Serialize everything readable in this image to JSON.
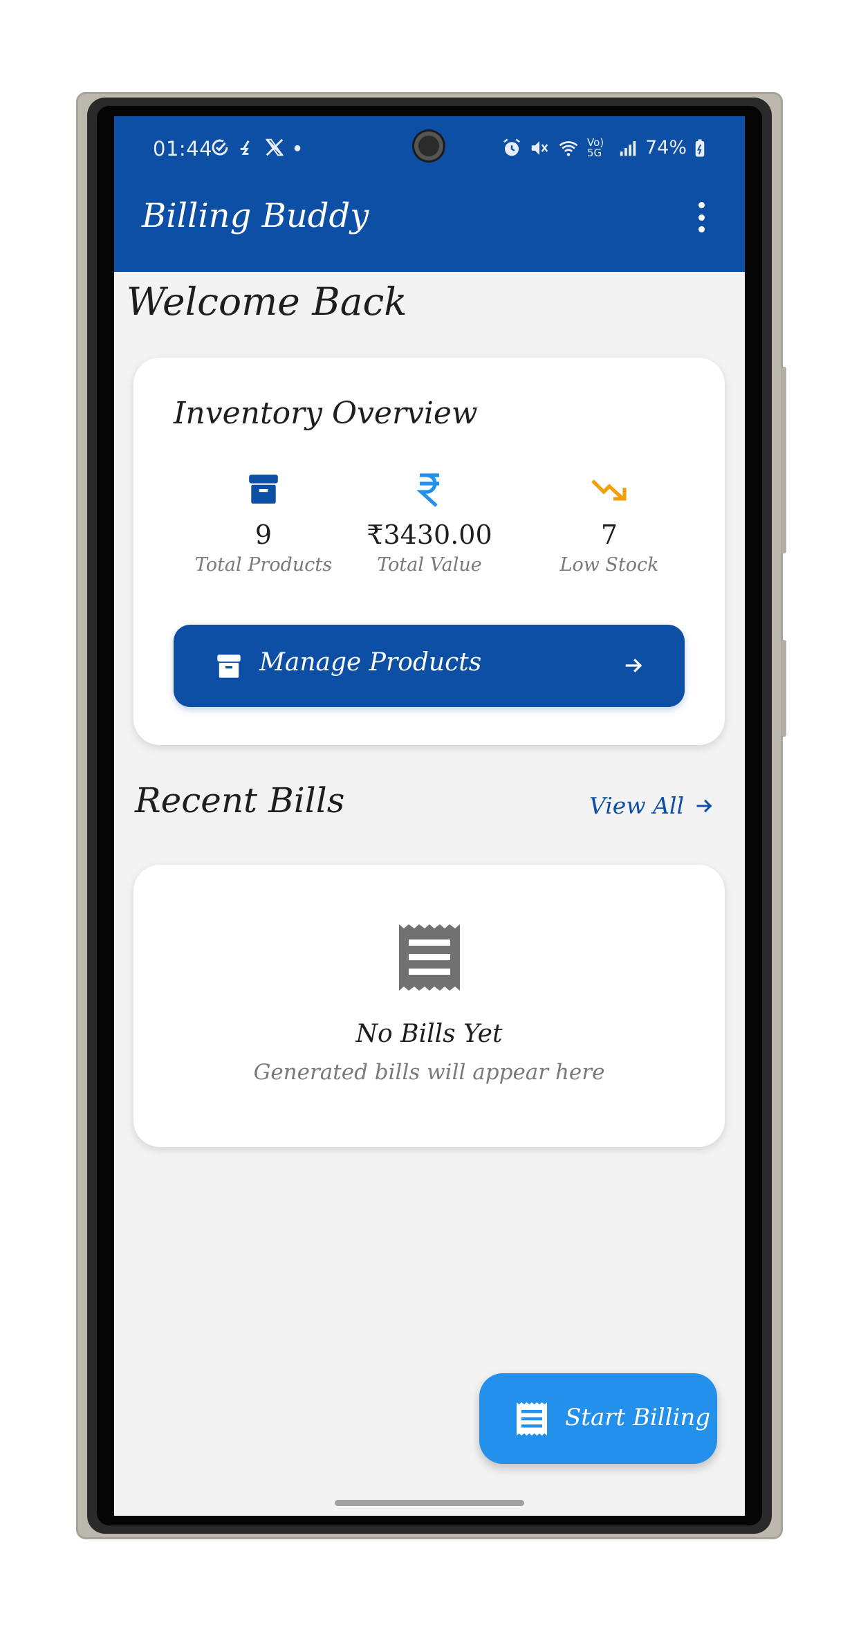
{
  "status_bar": {
    "time": "01:44",
    "left_icons": [
      "check-circle-icon",
      "threads-icon",
      "x-icon",
      "dot-icon"
    ],
    "right_icons": [
      "alarm-icon",
      "mute-icon",
      "wifi-icon",
      "volte-5g-icon",
      "signal-icon",
      "battery-charging-icon"
    ],
    "network_label": "Vo) 5G",
    "battery": "74%"
  },
  "app_bar": {
    "title": "Billing Buddy",
    "menu_icon": "more-vert-icon"
  },
  "welcome": "Welcome Back",
  "inventory": {
    "title": "Inventory Overview",
    "stats": [
      {
        "icon": "archive-box-icon",
        "icon_color": "#0d4fa5",
        "value": "9",
        "label": "Total Products"
      },
      {
        "icon": "rupee-icon",
        "icon_color": "#2391ec",
        "value": "₹3430.00",
        "label": "Total Value"
      },
      {
        "icon": "trending-down-icon",
        "icon_color": "#f2a00c",
        "value": "7",
        "label": "Low Stock"
      }
    ],
    "manage_button": {
      "label": "Manage Products",
      "icon": "archive-box-icon",
      "arrow": "arrow-right-icon"
    }
  },
  "recent_bills": {
    "title": "Recent Bills",
    "view_all": "View All",
    "empty": {
      "icon": "receipt-icon",
      "title": "No Bills Yet",
      "subtitle": "Generated bills will appear here"
    }
  },
  "fab": {
    "label": "Start Billing",
    "icon": "receipt-icon"
  },
  "colors": {
    "primary": "#0d4fa5",
    "accent": "#2391ec",
    "warning": "#f2a00c",
    "background": "#f3f3f3"
  }
}
